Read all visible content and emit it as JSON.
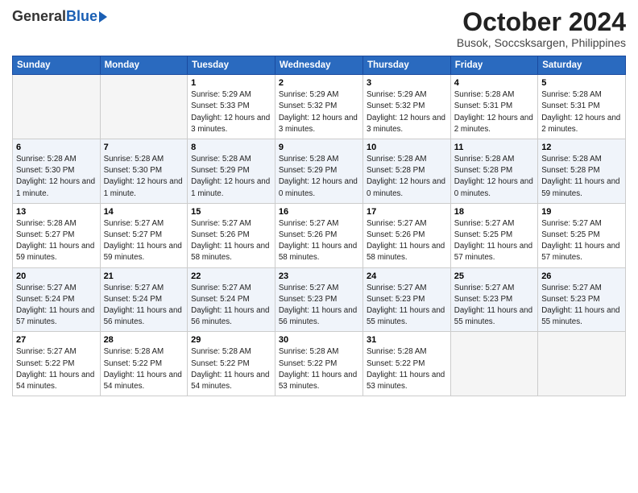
{
  "header": {
    "logo_general": "General",
    "logo_blue": "Blue",
    "month": "October 2024",
    "location": "Busok, Soccsksargen, Philippines"
  },
  "days_of_week": [
    "Sunday",
    "Monday",
    "Tuesday",
    "Wednesday",
    "Thursday",
    "Friday",
    "Saturday"
  ],
  "weeks": [
    [
      {
        "day": "",
        "info": ""
      },
      {
        "day": "",
        "info": ""
      },
      {
        "day": "1",
        "info": "Sunrise: 5:29 AM\nSunset: 5:33 PM\nDaylight: 12 hours and 3 minutes."
      },
      {
        "day": "2",
        "info": "Sunrise: 5:29 AM\nSunset: 5:32 PM\nDaylight: 12 hours and 3 minutes."
      },
      {
        "day": "3",
        "info": "Sunrise: 5:29 AM\nSunset: 5:32 PM\nDaylight: 12 hours and 3 minutes."
      },
      {
        "day": "4",
        "info": "Sunrise: 5:28 AM\nSunset: 5:31 PM\nDaylight: 12 hours and 2 minutes."
      },
      {
        "day": "5",
        "info": "Sunrise: 5:28 AM\nSunset: 5:31 PM\nDaylight: 12 hours and 2 minutes."
      }
    ],
    [
      {
        "day": "6",
        "info": "Sunrise: 5:28 AM\nSunset: 5:30 PM\nDaylight: 12 hours and 1 minute."
      },
      {
        "day": "7",
        "info": "Sunrise: 5:28 AM\nSunset: 5:30 PM\nDaylight: 12 hours and 1 minute."
      },
      {
        "day": "8",
        "info": "Sunrise: 5:28 AM\nSunset: 5:29 PM\nDaylight: 12 hours and 1 minute."
      },
      {
        "day": "9",
        "info": "Sunrise: 5:28 AM\nSunset: 5:29 PM\nDaylight: 12 hours and 0 minutes."
      },
      {
        "day": "10",
        "info": "Sunrise: 5:28 AM\nSunset: 5:28 PM\nDaylight: 12 hours and 0 minutes."
      },
      {
        "day": "11",
        "info": "Sunrise: 5:28 AM\nSunset: 5:28 PM\nDaylight: 12 hours and 0 minutes."
      },
      {
        "day": "12",
        "info": "Sunrise: 5:28 AM\nSunset: 5:28 PM\nDaylight: 11 hours and 59 minutes."
      }
    ],
    [
      {
        "day": "13",
        "info": "Sunrise: 5:28 AM\nSunset: 5:27 PM\nDaylight: 11 hours and 59 minutes."
      },
      {
        "day": "14",
        "info": "Sunrise: 5:27 AM\nSunset: 5:27 PM\nDaylight: 11 hours and 59 minutes."
      },
      {
        "day": "15",
        "info": "Sunrise: 5:27 AM\nSunset: 5:26 PM\nDaylight: 11 hours and 58 minutes."
      },
      {
        "day": "16",
        "info": "Sunrise: 5:27 AM\nSunset: 5:26 PM\nDaylight: 11 hours and 58 minutes."
      },
      {
        "day": "17",
        "info": "Sunrise: 5:27 AM\nSunset: 5:26 PM\nDaylight: 11 hours and 58 minutes."
      },
      {
        "day": "18",
        "info": "Sunrise: 5:27 AM\nSunset: 5:25 PM\nDaylight: 11 hours and 57 minutes."
      },
      {
        "day": "19",
        "info": "Sunrise: 5:27 AM\nSunset: 5:25 PM\nDaylight: 11 hours and 57 minutes."
      }
    ],
    [
      {
        "day": "20",
        "info": "Sunrise: 5:27 AM\nSunset: 5:24 PM\nDaylight: 11 hours and 57 minutes."
      },
      {
        "day": "21",
        "info": "Sunrise: 5:27 AM\nSunset: 5:24 PM\nDaylight: 11 hours and 56 minutes."
      },
      {
        "day": "22",
        "info": "Sunrise: 5:27 AM\nSunset: 5:24 PM\nDaylight: 11 hours and 56 minutes."
      },
      {
        "day": "23",
        "info": "Sunrise: 5:27 AM\nSunset: 5:23 PM\nDaylight: 11 hours and 56 minutes."
      },
      {
        "day": "24",
        "info": "Sunrise: 5:27 AM\nSunset: 5:23 PM\nDaylight: 11 hours and 55 minutes."
      },
      {
        "day": "25",
        "info": "Sunrise: 5:27 AM\nSunset: 5:23 PM\nDaylight: 11 hours and 55 minutes."
      },
      {
        "day": "26",
        "info": "Sunrise: 5:27 AM\nSunset: 5:23 PM\nDaylight: 11 hours and 55 minutes."
      }
    ],
    [
      {
        "day": "27",
        "info": "Sunrise: 5:27 AM\nSunset: 5:22 PM\nDaylight: 11 hours and 54 minutes."
      },
      {
        "day": "28",
        "info": "Sunrise: 5:28 AM\nSunset: 5:22 PM\nDaylight: 11 hours and 54 minutes."
      },
      {
        "day": "29",
        "info": "Sunrise: 5:28 AM\nSunset: 5:22 PM\nDaylight: 11 hours and 54 minutes."
      },
      {
        "day": "30",
        "info": "Sunrise: 5:28 AM\nSunset: 5:22 PM\nDaylight: 11 hours and 53 minutes."
      },
      {
        "day": "31",
        "info": "Sunrise: 5:28 AM\nSunset: 5:22 PM\nDaylight: 11 hours and 53 minutes."
      },
      {
        "day": "",
        "info": ""
      },
      {
        "day": "",
        "info": ""
      }
    ]
  ]
}
